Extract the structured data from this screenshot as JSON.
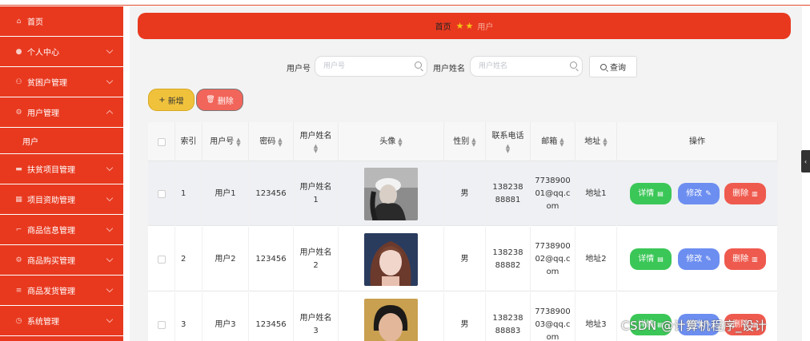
{
  "sidebar": {
    "items": [
      {
        "label": "首页",
        "icon": "home-icon",
        "glyph": "⌂"
      },
      {
        "label": "个人中心",
        "icon": "user-icon",
        "glyph": "●"
      },
      {
        "label": "贫困户管理",
        "icon": "users-icon",
        "glyph": "⚇"
      },
      {
        "label": "用户管理",
        "icon": "settings-icon",
        "glyph": "⚙"
      },
      {
        "label": "扶贫项目管理",
        "icon": "bank-icon",
        "glyph": "▬"
      },
      {
        "label": "项目资助管理",
        "icon": "grid-icon",
        "glyph": "▦"
      },
      {
        "label": "商品信息管理",
        "icon": "crop-icon",
        "glyph": "⌐"
      },
      {
        "label": "商品购买管理",
        "icon": "gear-icon",
        "glyph": "⚙"
      },
      {
        "label": "商品发货管理",
        "icon": "list-icon",
        "glyph": "≡"
      },
      {
        "label": "系统管理",
        "icon": "clock-icon",
        "glyph": "◷"
      }
    ],
    "submenu": {
      "label": "用户"
    }
  },
  "breadcrumb": {
    "home": "首页",
    "current": "用户"
  },
  "search": {
    "field1_label": "用户号",
    "field1_placeholder": "用户号",
    "field2_label": "用户姓名",
    "field2_placeholder": "用户姓名",
    "button_label": "查询"
  },
  "toolbar": {
    "add_label": "新增",
    "delete_label": "删除"
  },
  "table": {
    "headers": {
      "index": "索引",
      "account": "用户号",
      "password": "密码",
      "name": "用户姓名",
      "avatar": "头像",
      "gender": "性别",
      "phone": "联系电话",
      "email": "邮箱",
      "address": "地址",
      "actions": "操作"
    },
    "rows": [
      {
        "index": "1",
        "account": "用户1",
        "password": "123456",
        "name": "用户姓名1",
        "gender": "男",
        "phone": "13823888881",
        "email": "773890001@qq.com",
        "address": "地址1"
      },
      {
        "index": "2",
        "account": "用户2",
        "password": "123456",
        "name": "用户姓名2",
        "gender": "男",
        "phone": "13823888882",
        "email": "773890002@qq.com",
        "address": "地址2"
      },
      {
        "index": "3",
        "account": "用户3",
        "password": "123456",
        "name": "用户姓名3",
        "gender": "男",
        "phone": "13823888883",
        "email": "773890003@qq.com",
        "address": "地址3"
      }
    ],
    "actions": {
      "detail": "详情",
      "edit": "修改",
      "remove": "删除"
    }
  },
  "watermark": "CSDN @计算机程序_设计",
  "colors": {
    "brand": "#e8391f",
    "add": "#f0c23c",
    "detail": "#3bc757",
    "edit": "#6c8ef0",
    "remove": "#ef5a4e"
  }
}
